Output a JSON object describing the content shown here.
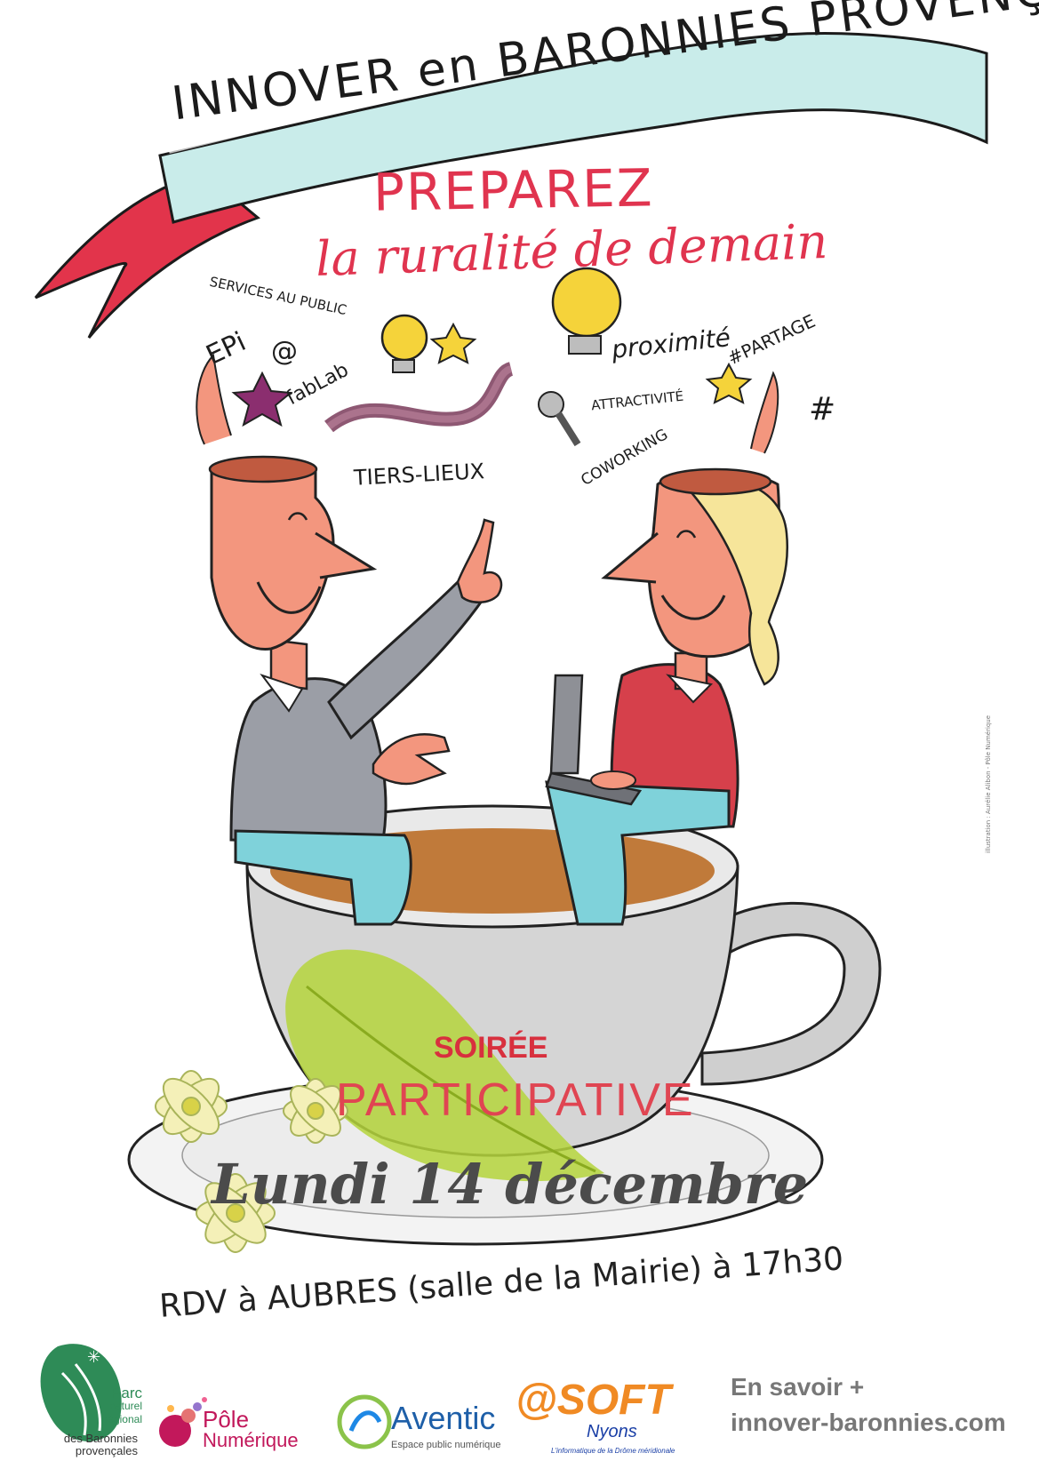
{
  "banner": {
    "title": "INNOVER en BARONNIES PROVENÇALES"
  },
  "headline": {
    "line1": "PREPAREZ",
    "line2": "la ruralité de demain"
  },
  "ideas": {
    "services": "SERVICES AU PUBLIC",
    "epi": "EPi",
    "at": "@",
    "fablab": "fabLab",
    "tiers_lieux": "TIERS-LIEUX",
    "proximite": "proximité",
    "partage": "#PARTAGE",
    "attractivite": "ATTRACTIVITÉ",
    "coworking": "COWORKING",
    "hash": "#"
  },
  "event": {
    "kind": "SOIRÉE",
    "kind2": "PARTICIPATIVE",
    "date": "Lundi 14 décembre",
    "venue": "RDV à AUBRES (salle de la Mairie) à 17h30"
  },
  "credit": "illustration : Aurélie Alibon - Pôle Numérique",
  "logos": {
    "parc": [
      "Parc",
      "naturel",
      "régional",
      "des Baronnies",
      "provençales"
    ],
    "pole": [
      "Pôle",
      "Numérique"
    ],
    "aventic": "Aventic",
    "aventic_sub": "Espace public numérique",
    "soft": "@SOFT",
    "soft_sub": "Nyons",
    "soft_tagline": "L'informatique de la Drôme méridionale"
  },
  "more_info": {
    "line1": "En savoir +",
    "line2": "innover-baronnies.com"
  },
  "colors": {
    "banner_band": "#c9ecea",
    "ribbon_red": "#e2344b",
    "title_red": "#e0344f",
    "skin": "#f3967e",
    "shirt_gray": "#9b9ea6",
    "shirt_red": "#d6404b",
    "pants": "#7fd2da",
    "coffee": "#c07a3a",
    "cup": "#d5d5d5",
    "leaf": "#b5d53c",
    "flower": "#f4f0b8"
  }
}
